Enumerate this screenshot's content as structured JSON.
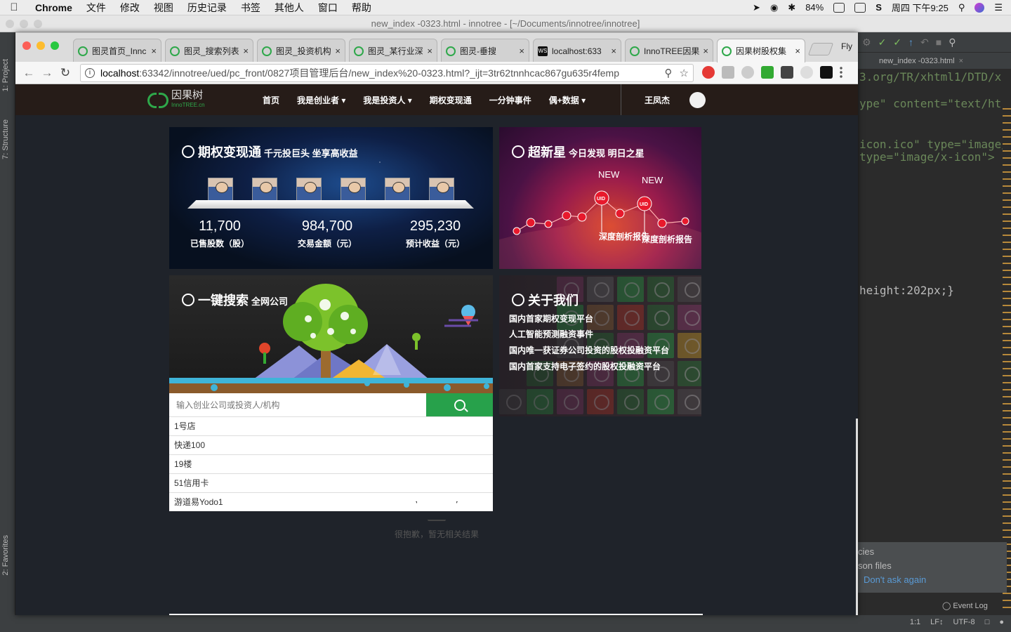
{
  "menubar": {
    "app": "Chrome",
    "items": [
      "文件",
      "修改",
      "视图",
      "历史记录",
      "书签",
      "其他人",
      "窗口",
      "帮助"
    ],
    "battery": "84%",
    "clock": "周四 下午9:25"
  },
  "ide": {
    "window_title": "new_index -0323.html - innotree - [~/Documents/innotree/innotree]",
    "left_tabs": [
      "1: Project",
      "7: Structure",
      "2: Favorites"
    ],
    "editor_tab": "new_index -0323.html",
    "code_lines": [
      "3.org/TR/xhtml1/DTD/x",
      "ype\" content=\"text/ht",
      "icon.ico\" type=\"image/",
      " type=\"image/x-icon\">",
      "height:202px;}"
    ],
    "notification": {
      "line1": "cies",
      "line2": "son files",
      "link": "Don't ask again"
    },
    "event_log": "Event Log",
    "status": [
      "1:1",
      "LF↕",
      "UTF-8"
    ]
  },
  "browser": {
    "tabs": [
      {
        "label": "图灵首页_Innc"
      },
      {
        "label": "图灵_搜索列表"
      },
      {
        "label": "图灵_投资机构"
      },
      {
        "label": "图灵_某行业深"
      },
      {
        "label": "图灵-垂搜"
      },
      {
        "label": "localhost:633"
      },
      {
        "label": "InnoTREE因果"
      },
      {
        "label": "因果树股权集"
      }
    ],
    "extra_button": "Fly",
    "url_host": "localhost",
    "url_path": ":63342/innotree/ued/pc_front/0827项目管理后台/new_index%20-0323.html?_ijt=3tr62tnnhcac867gu635r4femp"
  },
  "site": {
    "logo_text": "因果树",
    "logo_sub": "InnoTREE.cn",
    "nav": [
      "首页",
      "我是创业者 ▾",
      "我是投资人 ▾",
      "期权变现通",
      "一分钟事件",
      "偶+数据 ▾"
    ],
    "username": "王凤杰",
    "option_card": {
      "title": "期权变现通",
      "subtitle": "千元投巨头 坐享高收益",
      "stats": [
        {
          "value": "11,700",
          "label": "已售股数（股）"
        },
        {
          "value": "984,700",
          "label": "交易金额（元）"
        },
        {
          "value": "295,230",
          "label": "预计收益（元）"
        }
      ]
    },
    "star_card": {
      "title": "超新星",
      "subtitle": "今日发现 明日之星",
      "new_labels": [
        "NEW",
        "NEW"
      ],
      "node_label": "UID",
      "report_labels": [
        "深度剖析报告",
        "深度剖析报告"
      ]
    },
    "search_card": {
      "title": "一键搜索",
      "subtitle": "全网公司",
      "placeholder": "输入创业公司或投资人/机构",
      "results": [
        "1号店",
        "快递100",
        "19楼",
        "51信用卡",
        "游道易Yodo1"
      ]
    },
    "about_card": {
      "title": "关于我们",
      "lines": [
        "国内首家期权变现平台",
        "人工智能预测融资事件",
        "国内唯一获证券公司投资的股权投融资平台",
        "国内首家支持电子签约的股权投融资平台"
      ]
    },
    "empty_state": "很抱歉，暂无相关结果",
    "colors": {
      "brand_green": "#27a14b",
      "nav_bg": "#261c18",
      "page_bg": "#1f232a"
    }
  }
}
